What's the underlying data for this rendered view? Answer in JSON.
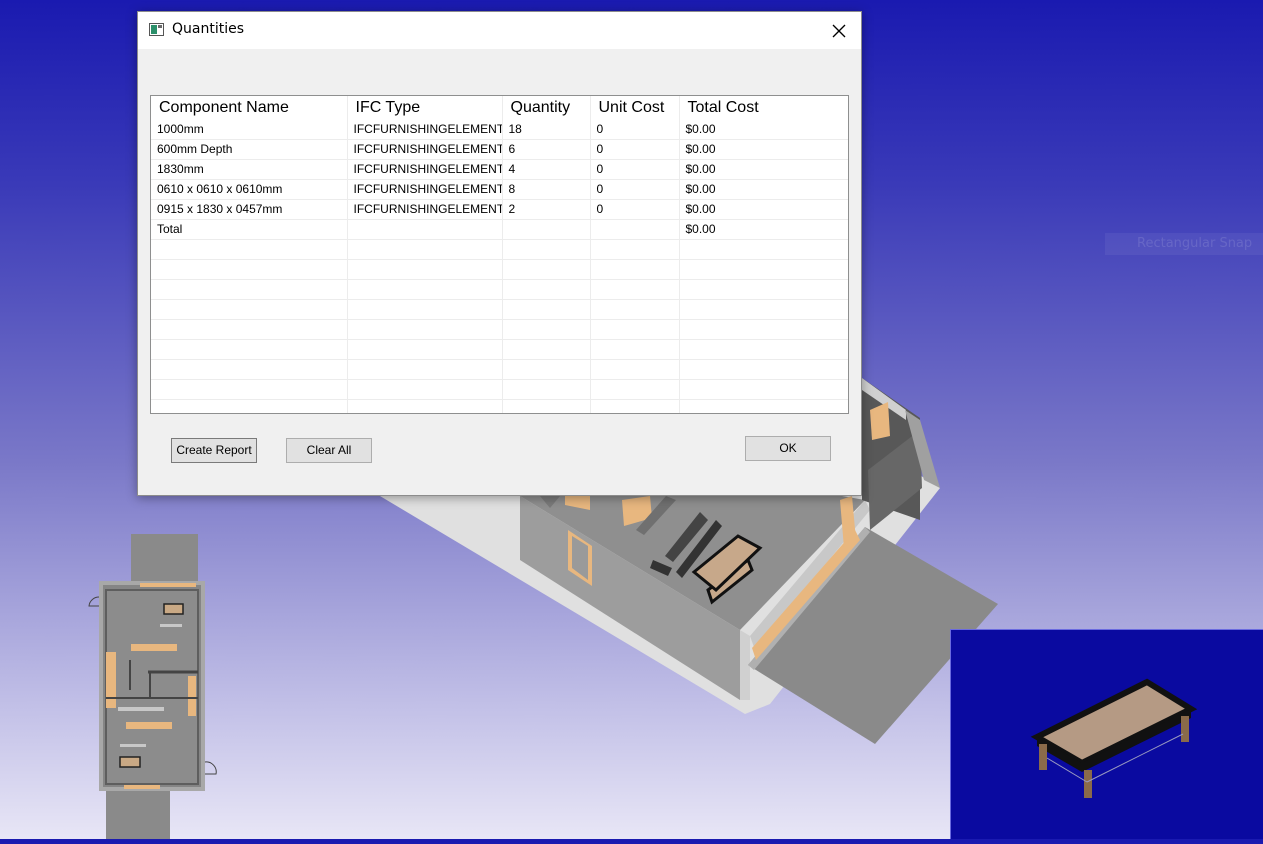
{
  "dialog": {
    "title": "Quantities",
    "close_icon": "close-icon",
    "app_icon": "window-icon"
  },
  "table": {
    "columns": [
      "Component Name",
      "IFC Type",
      "Quantity",
      "Unit Cost",
      "Total Cost"
    ],
    "rows": [
      [
        "1000mm",
        "IFCFURNISHINGELEMENT",
        "18",
        "0",
        "$0.00"
      ],
      [
        "600mm Depth",
        "IFCFURNISHINGELEMENT",
        "6",
        "0",
        "$0.00"
      ],
      [
        "1830mm",
        "IFCFURNISHINGELEMENT",
        "4",
        "0",
        "$0.00"
      ],
      [
        "0610 x 0610 x 0610mm",
        "IFCFURNISHINGELEMENT",
        "8",
        "0",
        "$0.00"
      ],
      [
        "0915 x 1830 x 0457mm",
        "IFCFURNISHINGELEMENT",
        "2",
        "0",
        "$0.00"
      ],
      [
        "Total",
        "",
        "",
        "",
        "$0.00"
      ]
    ]
  },
  "buttons": {
    "create_report": "Create Report",
    "clear_all": "Clear All",
    "ok": "OK"
  },
  "background": {
    "snap_label": "Rectangular Snap"
  }
}
